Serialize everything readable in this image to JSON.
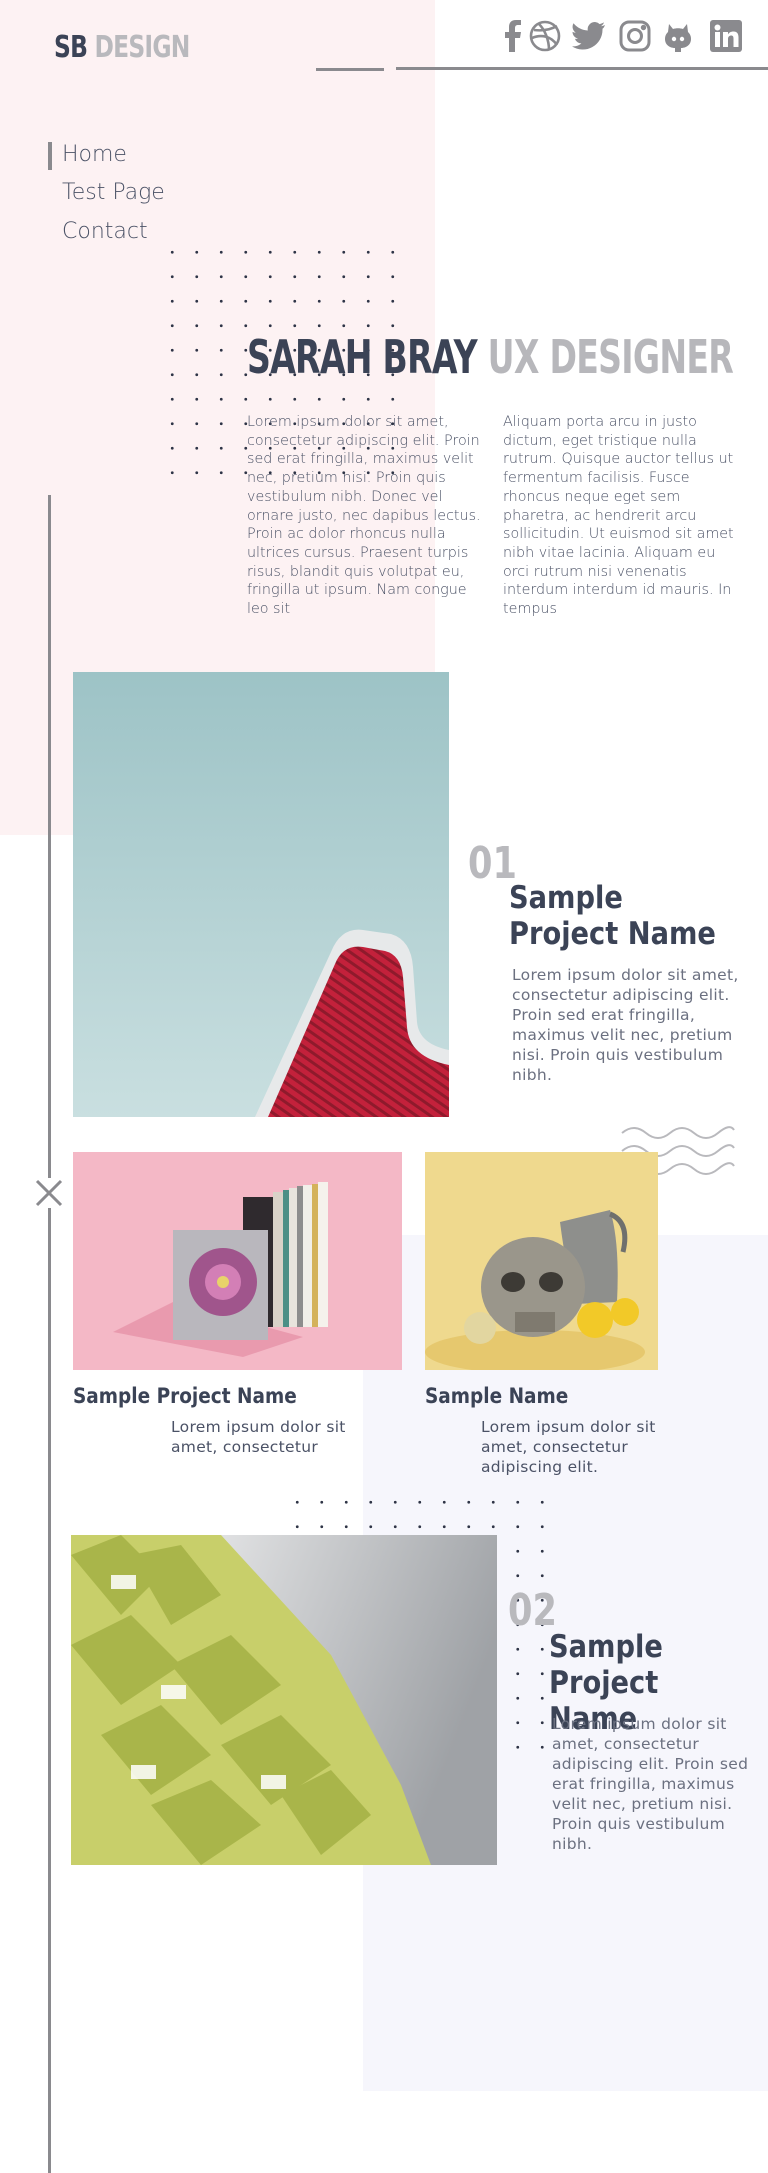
{
  "brand": {
    "logo_bold": "SB",
    "logo_light": "DESIGN"
  },
  "social": [
    {
      "icon": "facebook-icon"
    },
    {
      "icon": "dribbble-icon"
    },
    {
      "icon": "twitter-icon"
    },
    {
      "icon": "instagram-icon"
    },
    {
      "icon": "github-icon"
    },
    {
      "icon": "linkedin-icon"
    }
  ],
  "nav": {
    "items": [
      {
        "label": "Home"
      },
      {
        "label": "Test Page"
      },
      {
        "label": "Contact"
      }
    ],
    "active": "Home"
  },
  "hero": {
    "name": "SARAH BRAY",
    "role": "UX DESIGNER",
    "col1": "Lorem ipsum dolor sit amet, consectetur adipiscing elit. Proin sed erat fringilla, maximus velit nec, pretium nisi. Proin quis vestibulum nibh. Donec vel ornare justo, nec dapibus lectus. Proin ac dolor rhoncus nulla ultrices cursus. Praesent turpis risus, blandit quis volutpat eu, fringilla ut ipsum. Nam congue leo sit",
    "col2": "Aliquam porta arcu in justo dictum, eget tristique nulla rutrum. Quisque auctor tellus ut fermentum facilisis. Fusce rhoncus neque eget sem pharetra, ac hendrerit arcu sollicitudin. Ut euismod sit amet nibh vitae lacinia. Aliquam eu orci rutrum nisi venenatis interdum interdum id mauris. In tempus"
  },
  "project1": {
    "number": "01",
    "title_line1": "Sample",
    "title_line2": "Project Name",
    "desc": "Lorem ipsum dolor sit amet, consectetur adipiscing elit. Proin sed erat fringilla, maximus velit nec, pretium nisi. Proin quis vestibulum nibh."
  },
  "card1": {
    "title": "Sample Project Name",
    "desc": "Lorem ipsum dolor sit amet, consectetur"
  },
  "card2": {
    "title": "Sample Name",
    "desc": "Lorem ipsum dolor sit amet, consectetur adipiscing elit."
  },
  "project2": {
    "number": "02",
    "title_line1": "Sample",
    "title_line2": "Project Name",
    "desc": "Lorem ipsum dolor sit amet, consectetur adipiscing elit. Proin sed erat fringilla, maximus velit nec, pretium nisi. Proin quis vestibulum nibh."
  },
  "colors": {
    "accent_dark": "#3b4356",
    "muted_gray": "#b9b9bd",
    "pink_bg": "#fdf2f3",
    "lavender_bg": "#f6f6fc"
  }
}
